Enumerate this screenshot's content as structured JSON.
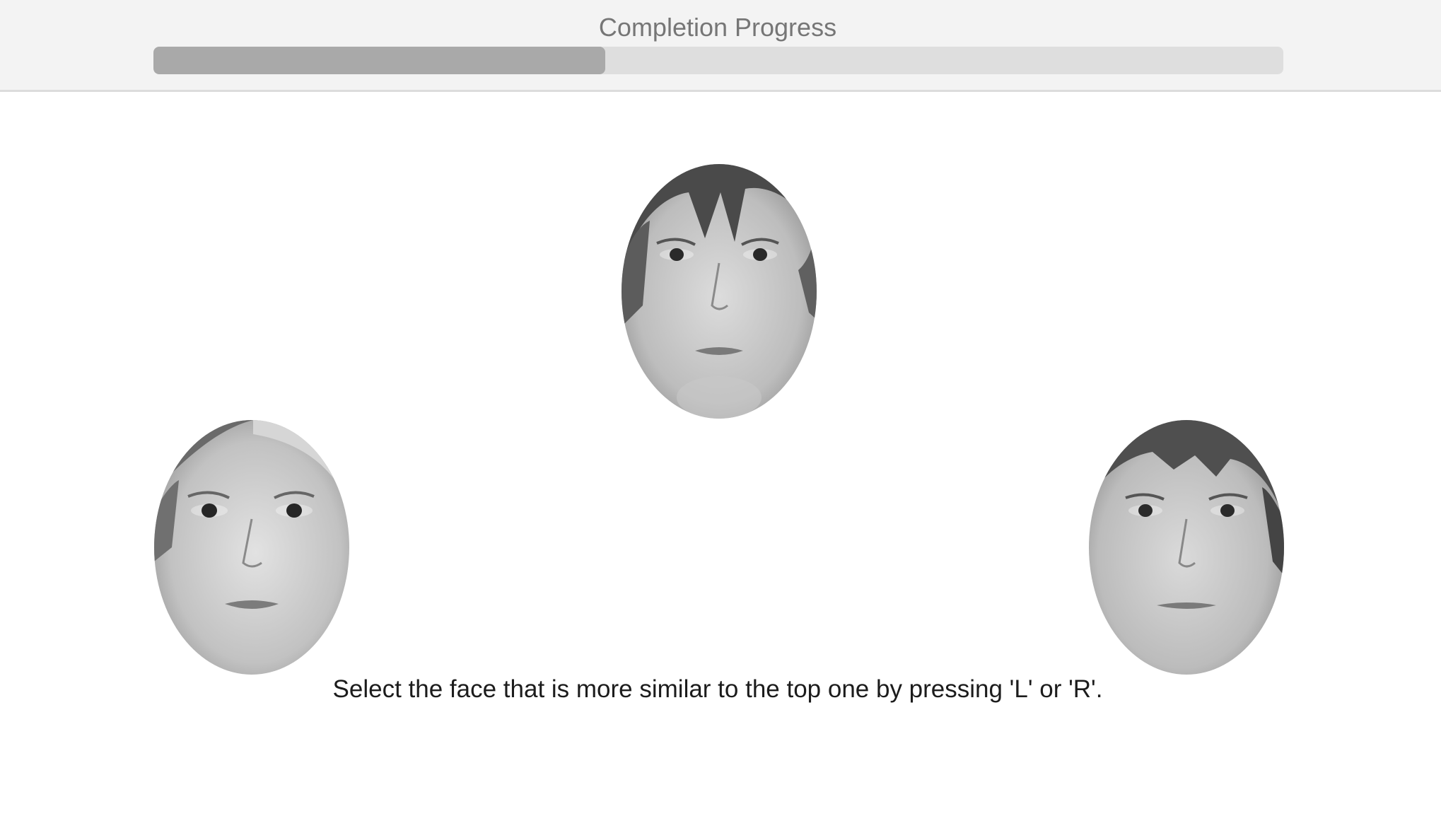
{
  "progress": {
    "title": "Completion Progress",
    "fraction": 0.4
  },
  "stimuli": {
    "top": {
      "icon": "face-photo-icon"
    },
    "left": {
      "icon": "face-photo-icon"
    },
    "right": {
      "icon": "face-photo-icon"
    }
  },
  "instruction": "Select the face that is more similar to the top one by pressing 'L' or 'R'.",
  "colors": {
    "header_bg": "#f3f3f3",
    "track": "#dedede",
    "fill": "#a9a9a9"
  }
}
